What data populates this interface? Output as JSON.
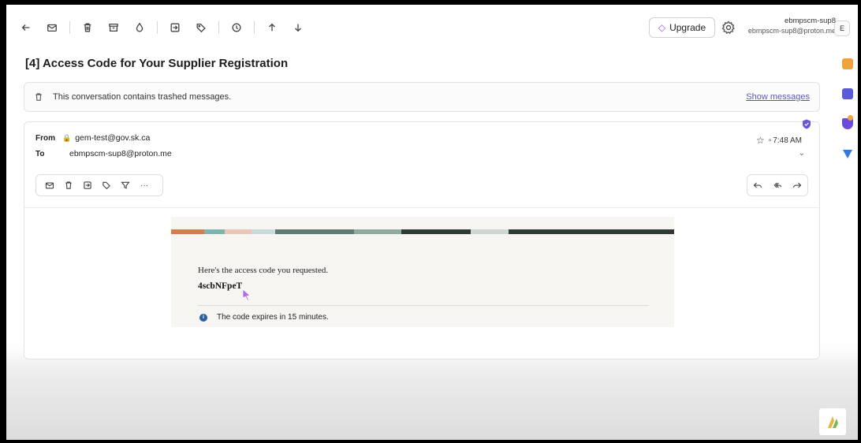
{
  "account": {
    "name": "ebmpscm-sup8",
    "email": "ebmpscm-sup8@proton.me",
    "avatar_initial": "E"
  },
  "toolbar": {
    "upgrade_label": "Upgrade",
    "icons": [
      "back-arrow-icon",
      "mark-unread-icon",
      "trash-icon",
      "archive-icon",
      "spam-icon",
      "move-to-folder-icon",
      "label-icon",
      "snooze-icon",
      "previous-arrow-icon",
      "next-arrow-icon",
      "gear-icon"
    ]
  },
  "subject": "[4] Access Code for Your Supplier Registration",
  "banner": {
    "text": "This conversation contains trashed messages.",
    "link": "Show messages"
  },
  "message": {
    "from_label": "From",
    "from": "gem-test@gov.sk.ca",
    "to_label": "To",
    "to": "ebmpscm-sup8@proton.me",
    "time": "7:48 AM",
    "more_label": "···",
    "body": {
      "intro": "Here's the access code you requested.",
      "code": "4scbNFpeT",
      "info": "The code expires in 15 minutes."
    }
  },
  "colors": {
    "accent": "#8a5cf6",
    "info": "#2d5fa0",
    "link": "#5a5aa8"
  }
}
